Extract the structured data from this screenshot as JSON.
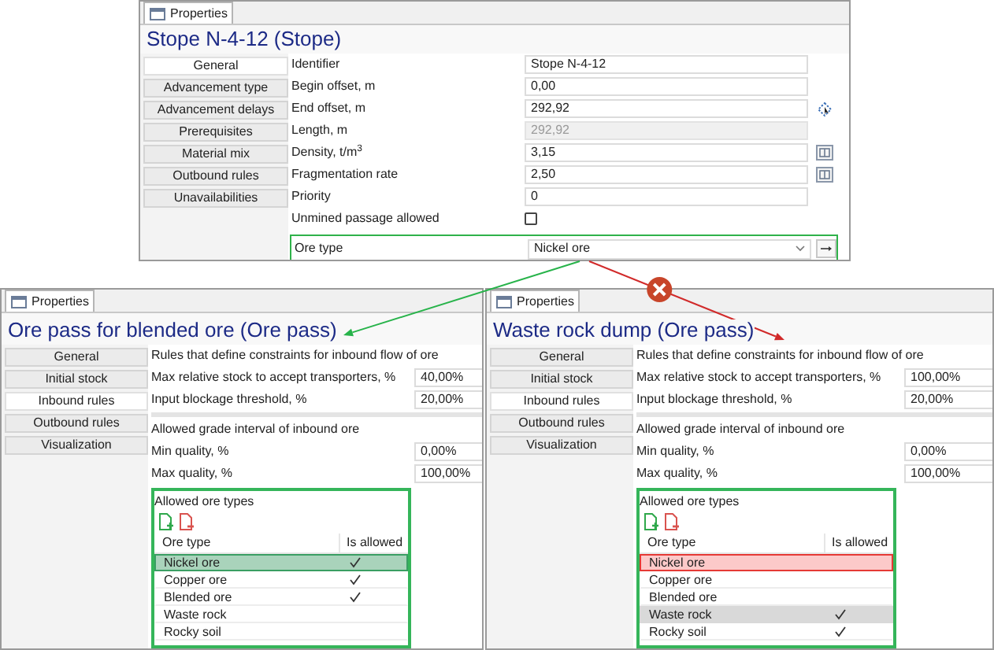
{
  "stope_panel": {
    "tab": "Properties",
    "title": "Stope N-4-12 (Stope)",
    "sections": [
      {
        "label": "General",
        "selected": true
      },
      {
        "label": "Advancement type",
        "selected": false
      },
      {
        "label": "Advancement delays",
        "selected": false
      },
      {
        "label": "Prerequisites",
        "selected": false
      },
      {
        "label": "Material mix",
        "selected": false
      },
      {
        "label": "Outbound rules",
        "selected": false
      },
      {
        "label": "Unavailabilities",
        "selected": false
      }
    ],
    "fields": [
      {
        "kind": "text",
        "label": "Identifier",
        "value": "Stope N-4-12"
      },
      {
        "kind": "text",
        "label": "Begin offset, m",
        "value": "0,00"
      },
      {
        "kind": "text",
        "label": "End offset, m",
        "value": "292,92",
        "button": {
          "kind": "pick"
        }
      },
      {
        "kind": "readonly",
        "label": "Length, m",
        "value": "292,92"
      },
      {
        "kind": "text",
        "label": "Density, t/m$^{3}$",
        "value": "3,15",
        "button": {
          "kind": "table"
        }
      },
      {
        "kind": "text",
        "label": "Fragmentation rate",
        "value": "2,50",
        "button": {
          "kind": "table"
        }
      },
      {
        "kind": "text",
        "label": "Priority",
        "value": "0"
      },
      {
        "kind": "checkbox",
        "label": "Unmined passage allowed",
        "checked": false
      },
      {
        "kind": "combo",
        "label": "Ore type",
        "value": "Nickel ore",
        "button": {
          "kind": "navigate"
        },
        "highlighted": true
      }
    ]
  },
  "connectors": [
    {
      "kind": "accepted"
    },
    {
      "kind": "rejected"
    }
  ],
  "ore_panels": [
    {
      "tab": "Properties",
      "title": "Ore pass for blended ore (Ore pass)",
      "sections": [
        {
          "label": "General",
          "selected": false
        },
        {
          "label": "Initial stock",
          "selected": false
        },
        {
          "label": "Inbound rules",
          "selected": true
        },
        {
          "label": "Outbound rules",
          "selected": false
        },
        {
          "label": "Visualization",
          "selected": false
        }
      ],
      "intro": "Rules that define constraints for inbound flow of ore",
      "fields": [
        {
          "label": "Max relative stock to accept transporters, %",
          "value": "40,00%"
        },
        {
          "label": "Input blockage threshold, %",
          "value": "20,00%"
        }
      ],
      "grade_heading": "Allowed grade interval of inbound ore",
      "grade_fields": [
        {
          "label": "Min quality, %",
          "value": "0,00%"
        },
        {
          "label": "Max quality, %",
          "value": "100,00%"
        }
      ],
      "ore_types": {
        "heading": "Allowed ore types",
        "highlighted": true,
        "columns": [
          "Ore type",
          "Is allowed"
        ],
        "rows": [
          {
            "name": "Nickel ore",
            "allowed": true,
            "selected": true,
            "matched": true
          },
          {
            "name": "Copper ore",
            "allowed": true,
            "selected": false
          },
          {
            "name": "Blended ore",
            "allowed": true,
            "selected": false
          },
          {
            "name": "Waste rock",
            "allowed": false,
            "selected": false
          },
          {
            "name": "Rocky soil",
            "allowed": false,
            "selected": false
          }
        ]
      }
    },
    {
      "tab": "Properties",
      "title": "Waste rock dump (Ore pass)",
      "sections": [
        {
          "label": "General",
          "selected": false
        },
        {
          "label": "Initial stock",
          "selected": false
        },
        {
          "label": "Inbound rules",
          "selected": true
        },
        {
          "label": "Outbound rules",
          "selected": false
        },
        {
          "label": "Visualization",
          "selected": false
        }
      ],
      "intro": "Rules that define constraints for inbound flow of ore",
      "fields": [
        {
          "label": "Max relative stock to accept transporters, %",
          "value": "100,00%"
        },
        {
          "label": "Input blockage threshold, %",
          "value": "20,00%"
        }
      ],
      "grade_heading": "Allowed grade interval of inbound ore",
      "grade_fields": [
        {
          "label": "Min quality, %",
          "value": "0,00%"
        },
        {
          "label": "Max quality, %",
          "value": "100,00%"
        }
      ],
      "ore_types": {
        "heading": "Allowed ore types",
        "highlighted": true,
        "columns": [
          "Ore type",
          "Is allowed"
        ],
        "rows": [
          {
            "name": "Nickel ore",
            "allowed": false,
            "selected": false,
            "conflicting": true
          },
          {
            "name": "Copper ore",
            "allowed": false,
            "selected": false
          },
          {
            "name": "Blended ore",
            "allowed": false,
            "selected": false
          },
          {
            "name": "Waste rock",
            "allowed": true,
            "selected": true
          },
          {
            "name": "Rocky soil",
            "allowed": true,
            "selected": false
          }
        ]
      }
    }
  ]
}
